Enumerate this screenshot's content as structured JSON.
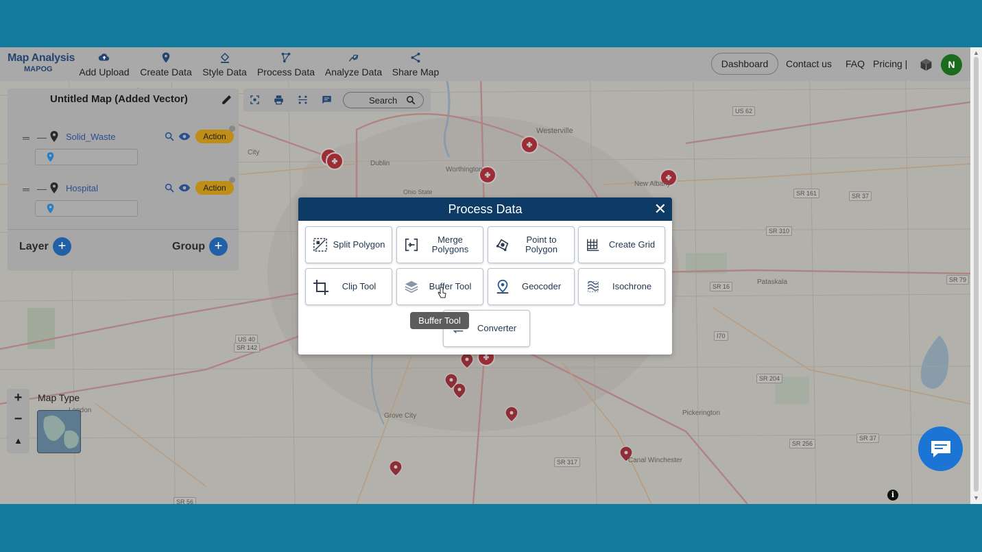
{
  "app": {
    "brand_title": "Map Analysis",
    "brand_sub": "MAPOG"
  },
  "nav": {
    "items": [
      {
        "label": "Add Upload",
        "icon": "cloud-upload-icon"
      },
      {
        "label": "Create Data",
        "icon": "map-pin-icon"
      },
      {
        "label": "Style Data",
        "icon": "paint-bucket-icon"
      },
      {
        "label": "Process Data",
        "icon": "process-icon"
      },
      {
        "label": "Analyze Data",
        "icon": "analyze-icon"
      },
      {
        "label": "Share Map",
        "icon": "share-icon"
      }
    ],
    "dashboard": "Dashboard",
    "contact": "Contact us",
    "faq": "FAQ",
    "pricing": "Pricing |",
    "avatar_initial": "N"
  },
  "panel": {
    "title": "Untitled Map (Added Vector)",
    "layers": [
      {
        "name": "Solid_Waste",
        "action": "Action"
      },
      {
        "name": "Hospital",
        "action": "Action"
      }
    ],
    "layer_label": "Layer",
    "group_label": "Group",
    "plus": "+"
  },
  "toolbar": {
    "search_label": "Search"
  },
  "map": {
    "type_label": "Map Type",
    "zoom_in": "+",
    "zoom_out": "−",
    "reset": "▲",
    "info": "i",
    "places": [
      "Westerville",
      "Worthington",
      "Dublin",
      "Ohio State",
      "New Albany",
      "Pataskala",
      "Grove City",
      "Pickerington",
      "Canal Winchester",
      "City",
      "London"
    ],
    "shields": [
      "US 62",
      "SR 161",
      "SR 37",
      "SR 310",
      "SR 16",
      "SR 79",
      "US 40",
      "SR 142",
      "SR 204",
      "SR 256",
      "SR 37",
      "SR 317",
      "SR 56",
      "I70"
    ]
  },
  "modal": {
    "title": "Process Data",
    "close": "✕",
    "tools": [
      {
        "label": "Split Polygon",
        "icon": "split-polygon-icon"
      },
      {
        "label": "Merge Polygons",
        "icon": "merge-polygons-icon"
      },
      {
        "label": "Point to Polygon",
        "icon": "point-to-polygon-icon"
      },
      {
        "label": "Create Grid",
        "icon": "grid-icon"
      },
      {
        "label": "Clip Tool",
        "icon": "crop-icon"
      },
      {
        "label": "Buffer Tool",
        "icon": "layers-icon"
      },
      {
        "label": "Geocoder",
        "icon": "geocoder-pin-icon"
      },
      {
        "label": "Isochrone",
        "icon": "isochrone-icon"
      },
      {
        "label": "Converter",
        "icon": "converter-icon"
      }
    ],
    "tooltip": "Buffer Tool"
  },
  "colors": {
    "frame": "#127a9c",
    "modal_header": "#0d3b66",
    "action_badge": "#bf8e16",
    "avatar": "#1d6b1f",
    "chat": "#1c74d4",
    "accent_blue": "#2160a6"
  }
}
